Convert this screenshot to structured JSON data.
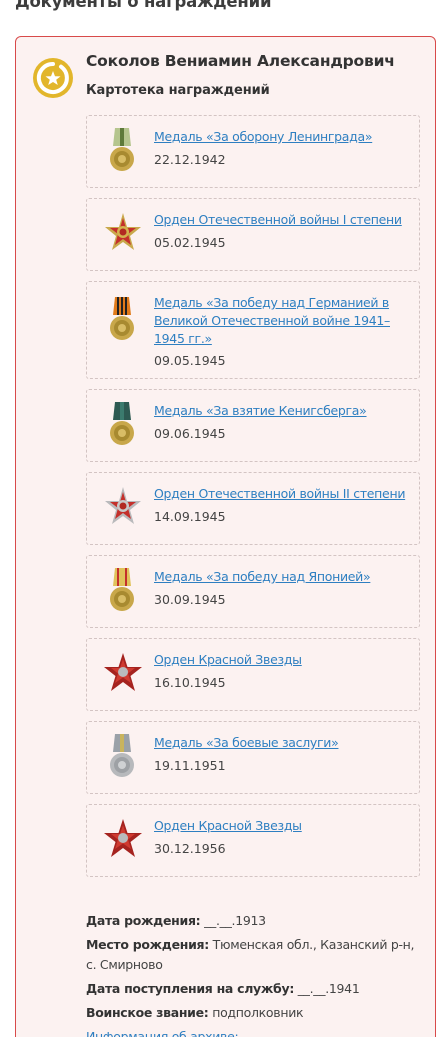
{
  "section": {
    "title": "Документы о награждении"
  },
  "person": {
    "name": "Соколов Вениамин Александрович",
    "card_subtitle": "Картотека награждений"
  },
  "awards": [
    {
      "title": "Медаль «За оборону Ленинграда»",
      "date": "22.12.1942",
      "icon": "medal-leningrad-icon"
    },
    {
      "title": "Орден Отечественной войны I степени",
      "date": "05.02.1945",
      "icon": "order-patriotic-war-1-icon"
    },
    {
      "title": "Медаль «За победу над Германией в Великой Отечественной войне 1941–1945 гг.»",
      "date": "09.05.1945",
      "icon": "medal-victory-germany-icon"
    },
    {
      "title": "Медаль «За взятие Кенигсберга»",
      "date": "09.06.1945",
      "icon": "medal-koenigsberg-icon"
    },
    {
      "title": "Орден Отечественной войны II степени",
      "date": "14.09.1945",
      "icon": "order-patriotic-war-2-icon"
    },
    {
      "title": "Медаль «За победу над Японией»",
      "date": "30.09.1945",
      "icon": "medal-victory-japan-icon"
    },
    {
      "title": "Орден Красной Звезды",
      "date": "16.10.1945",
      "icon": "order-red-star-icon"
    },
    {
      "title": "Медаль «За боевые заслуги»",
      "date": "19.11.1951",
      "icon": "medal-combat-merit-icon"
    },
    {
      "title": "Орден Красной Звезды",
      "date": "30.12.1956",
      "icon": "order-red-star-icon"
    }
  ],
  "info": {
    "birth_date_label": "Дата рождения:",
    "birth_date": "__.__.1913",
    "birth_place_label": "Место рождения:",
    "birth_place": "Тюменская обл., Казанский р-н, с. Смирново",
    "service_start_label": "Дата поступления на службу:",
    "service_start": "__.__.1941",
    "rank_label": "Воинское звание:",
    "rank": "подполковник",
    "archive_link": "Информация об архиве:"
  },
  "colors": {
    "accent_red": "#d84a4a",
    "card_bg": "#fcf2f1",
    "link_blue": "#2e7fc1",
    "badge_gold": "#e2b62b"
  }
}
